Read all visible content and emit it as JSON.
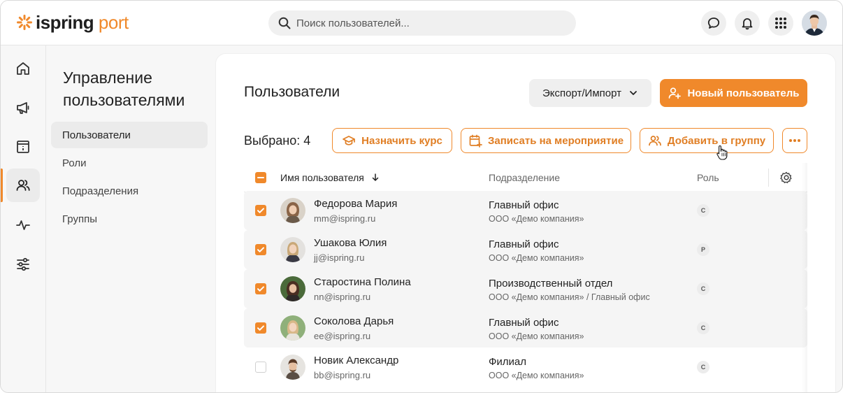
{
  "header": {
    "logo_part1": "ispring",
    "logo_part2": " port",
    "search_placeholder": "Поиск пользователей..."
  },
  "submenu": {
    "title": "Управление пользователями",
    "items": [
      "Пользователи",
      "Роли",
      "Подразделения",
      "Группы"
    ]
  },
  "main": {
    "title": "Пользователи",
    "export_label": "Экспорт/Импорт",
    "new_user_label": "Новый пользователь",
    "selected_label": "Выбрано: 4",
    "assign_course_label": "Назначить курс",
    "enroll_event_label": "Записать на мероприятие",
    "add_group_label": "Добавить в группу"
  },
  "table": {
    "col_name": "Имя пользователя",
    "col_dept": "Подразделение",
    "col_role": "Роль",
    "rows": [
      {
        "name": "Федорова Мария",
        "email": "mm@ispring.ru",
        "dept": "Главный офис",
        "company": "ООО «Демо компания»",
        "role": "С"
      },
      {
        "name": "Ушакова Юлия",
        "email": "jj@ispring.ru",
        "dept": "Главный офис",
        "company": "ООО «Демо компания»",
        "role": "Р"
      },
      {
        "name": "Старостина Полина",
        "email": "nn@ispring.ru",
        "dept": "Производственный отдел",
        "company": "ООО «Демо компания» / Главный офис",
        "role": "С"
      },
      {
        "name": "Соколова Дарья",
        "email": "ee@ispring.ru",
        "dept": "Главный офис",
        "company": "ООО «Демо компания»",
        "role": "С"
      },
      {
        "name": "Новик Александр",
        "email": "bb@ispring.ru",
        "dept": "Филиал",
        "company": "ООО «Демо компания»",
        "role": "С"
      }
    ]
  },
  "colors": {
    "accent": "#f0892b"
  }
}
